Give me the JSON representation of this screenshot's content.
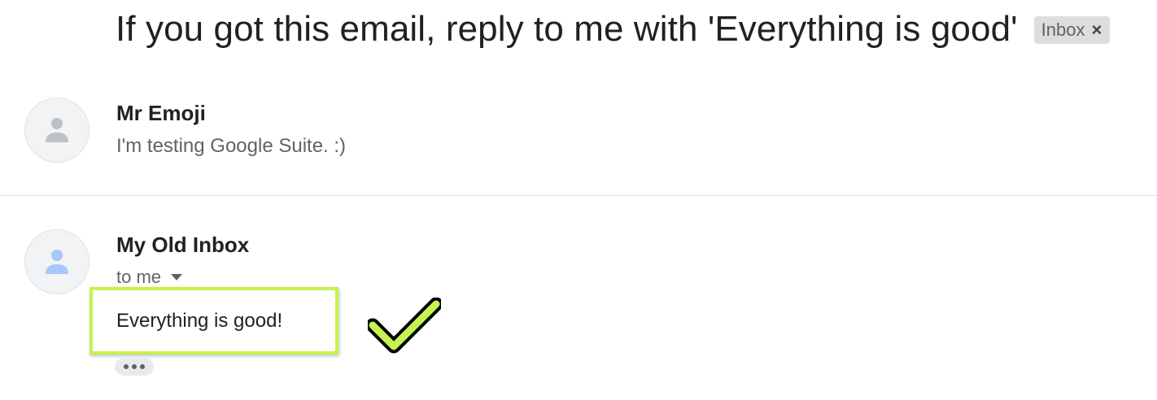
{
  "thread": {
    "subject": "If you got this email, reply to me with 'Everything is good'",
    "label": "Inbox",
    "label_close": "×"
  },
  "messages": [
    {
      "sender": "Mr Emoji",
      "snippet": "I'm testing Google Suite. :)",
      "avatar_icon": "person-icon",
      "avatar_color": "#bdc1c6"
    },
    {
      "sender": "My Old Inbox",
      "recipient": "to me",
      "body": "Everything is good!",
      "avatar_icon": "person-icon",
      "avatar_color": "#a8c7fa",
      "highlight_color": "#c7f24f"
    }
  ],
  "annotation": {
    "icon": "checkmark-icon",
    "color": "#c7f24f"
  }
}
